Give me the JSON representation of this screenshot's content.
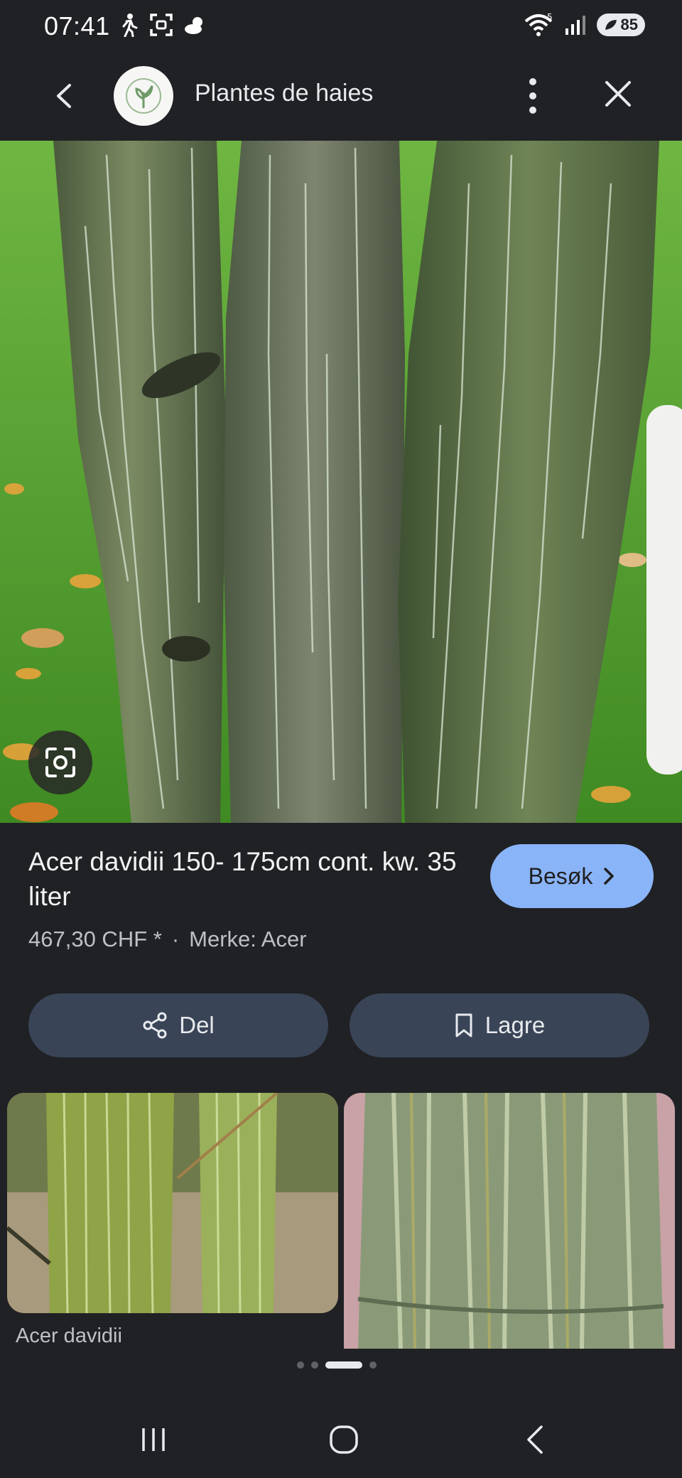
{
  "status_bar": {
    "time": "07:41",
    "battery": "85",
    "icons": [
      "walking-icon",
      "screenshot-icon",
      "weather-icon",
      "wifi-icon",
      "signal-icon",
      "battery-icon"
    ]
  },
  "top_bar": {
    "title": "Plantes de haies",
    "icons": [
      "back-icon",
      "site-logo",
      "more-vert-icon",
      "close-icon"
    ]
  },
  "product": {
    "title": "Acer davidii 150- 175cm cont. kw. 35 liter",
    "price": "467,30 CHF *",
    "separator": "·",
    "brand": "Merke: Acer",
    "visit_label": "Besøk",
    "share_label": "Del",
    "save_label": "Lagre"
  },
  "thumbnails": {
    "caption": "Acer davidii"
  },
  "colors": {
    "background": "#202124",
    "accent_button": "#8ab4f8",
    "action_button": "#394457"
  }
}
